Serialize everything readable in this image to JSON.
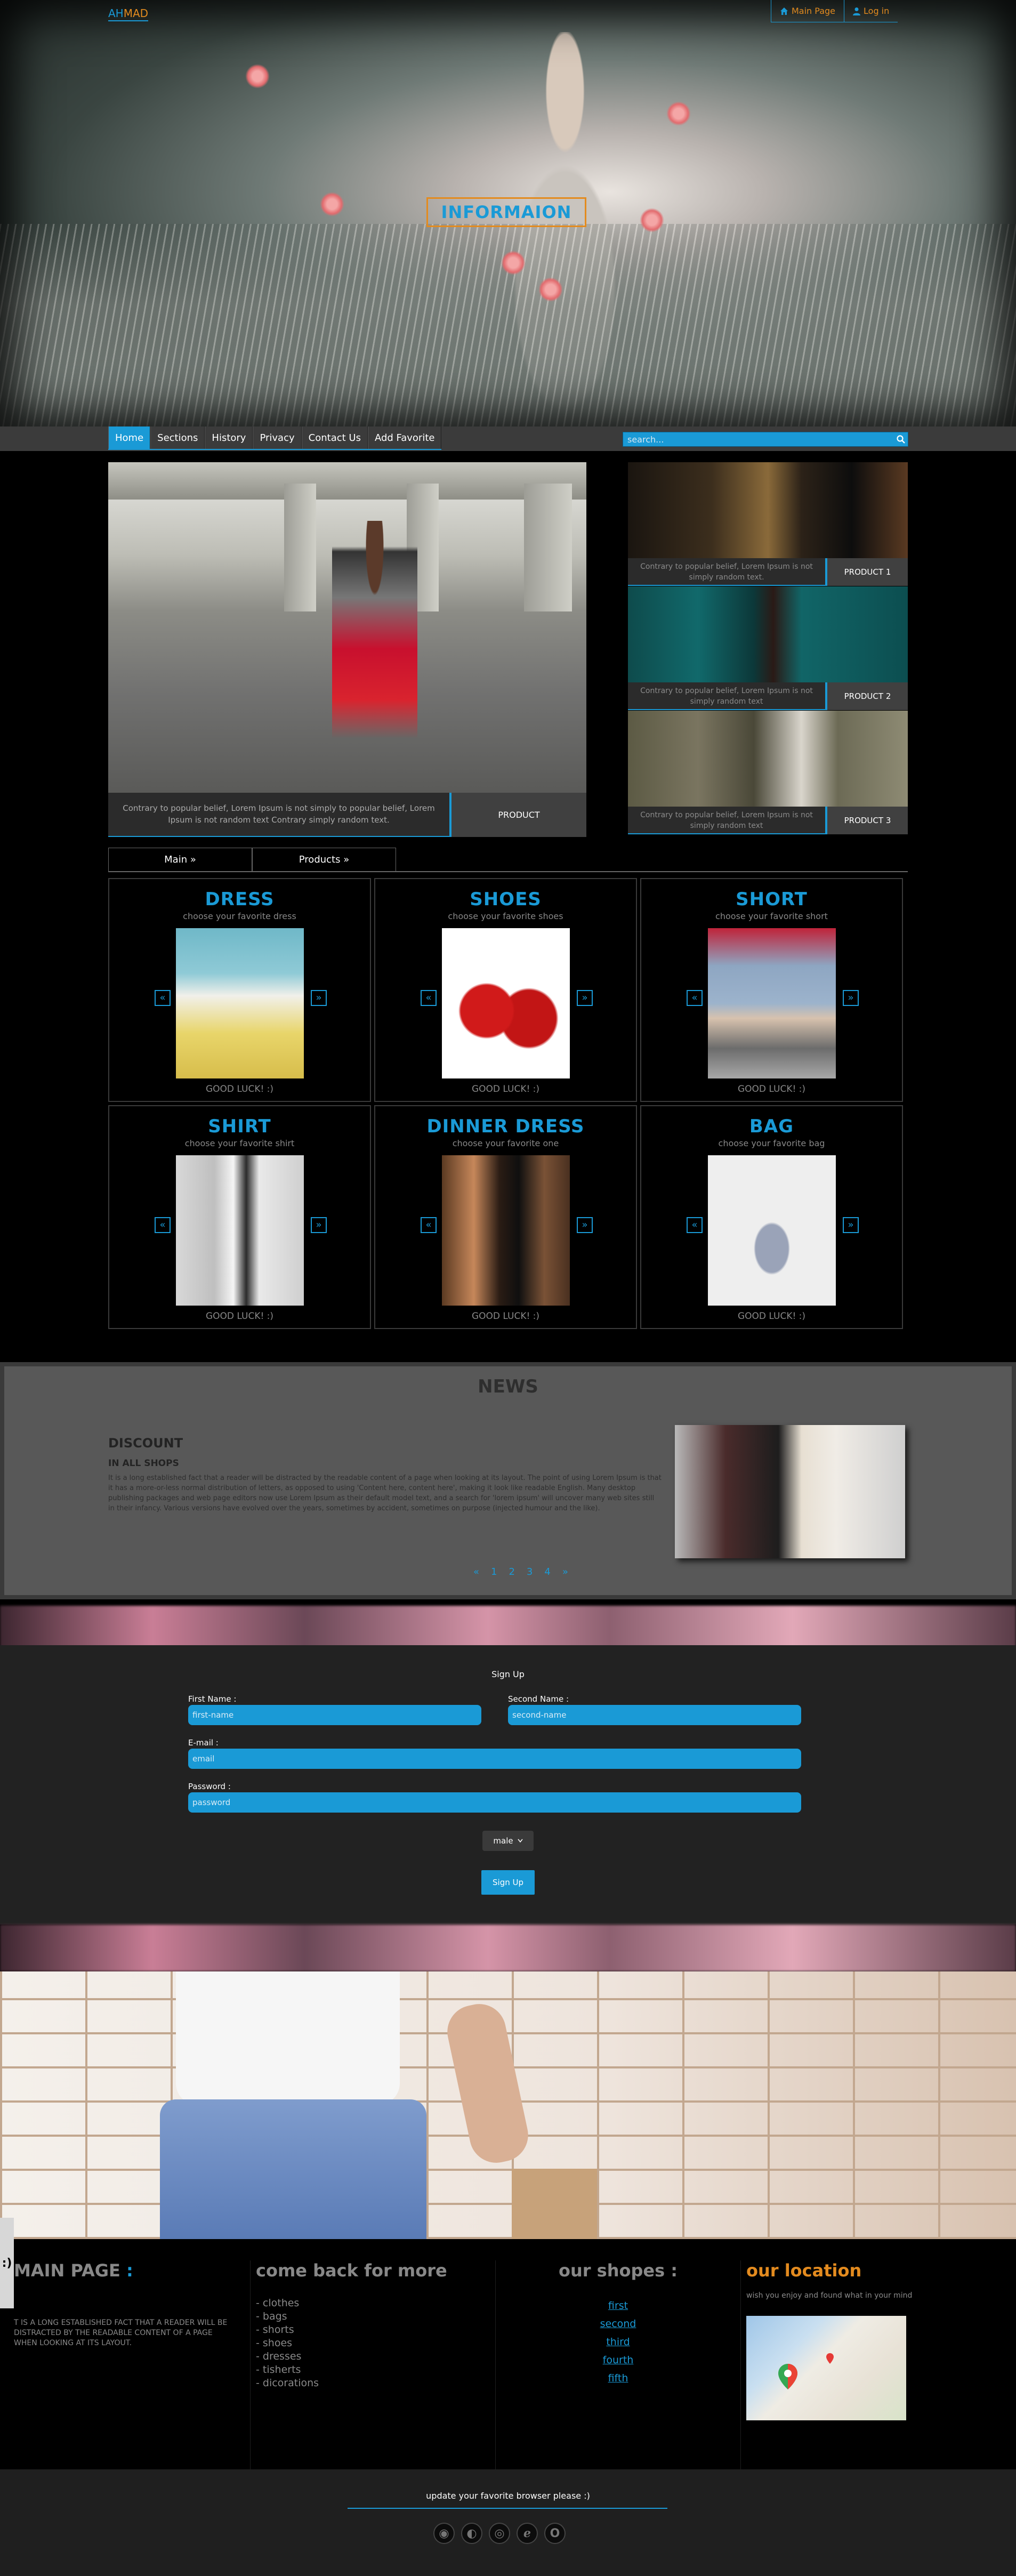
{
  "header": {
    "logo_a": "AH",
    "logo_b": "MAD",
    "top_links": [
      {
        "label": "Main Page",
        "icon": "home-icon"
      },
      {
        "label": "Log in",
        "icon": "user-icon"
      }
    ],
    "hero_title": "INFORMAION"
  },
  "nav": {
    "items": [
      "Home",
      "Sections",
      "History",
      "Privacy",
      "Contact Us",
      "Add Favorite"
    ],
    "search_placeholder": "search..."
  },
  "featured": {
    "main_caption": "Contrary to popular belief, Lorem Ipsum is not simply to popular belief, Lorem Ipsum is not random text Contrary simply random text.",
    "main_button": "PRODUCT",
    "side": [
      {
        "caption": "Contrary to popular belief, Lorem Ipsum is not simply random text.",
        "button": "PRODUCT 1"
      },
      {
        "caption": "Contrary to popular belief, Lorem Ipsum is not simply random text",
        "button": "PRODUCT 2"
      },
      {
        "caption": "Contrary to popular belief, Lorem Ipsum is not simply random text",
        "button": "PRODUCT 3"
      }
    ]
  },
  "subtabs": [
    "Main »",
    "Products »"
  ],
  "products": [
    {
      "title": "DRESS",
      "subtitle": "choose your favorite dress",
      "footer": "GOOD LUCK! :)"
    },
    {
      "title": "SHOES",
      "subtitle": "choose your favorite shoes",
      "footer": "GOOD LUCK! :)"
    },
    {
      "title": "SHORT",
      "subtitle": "choose your favorite short",
      "footer": "GOOD LUCK! :)"
    },
    {
      "title": "SHIRT",
      "subtitle": "choose your favorite shirt",
      "footer": "GOOD LUCK! :)"
    },
    {
      "title": "DINNER DRESS",
      "subtitle": "choose your favorite one",
      "footer": "GOOD LUCK! :)"
    },
    {
      "title": "BAG",
      "subtitle": "choose your favorite bag",
      "footer": "GOOD LUCK! :)"
    }
  ],
  "arrows": {
    "left": "«",
    "right": "»"
  },
  "news": {
    "heading": "NEWS",
    "title": "DISCOUNT",
    "subtitle": "IN ALL SHOPS",
    "body": "It is a long established fact that a reader will be distracted by the readable content of a page when looking at its layout. The point of using Lorem Ipsum is that it has a more-or-less normal distribution of letters, as opposed to using 'Content here, content here', making it look like readable English. Many desktop publishing packages and web page editors now use Lorem Ipsum as their default model text, and a search for 'lorem ipsum' will uncover many web sites still in their infancy. Various versions have evolved over the years, sometimes by accident, sometimes on purpose (injected humour and the like).",
    "pager": [
      "«",
      "1",
      "2",
      "3",
      "4",
      "»"
    ]
  },
  "signup": {
    "title": "Sign Up",
    "first_label": "First Name :",
    "first_placeholder": "first-name",
    "second_label": "Second Name :",
    "second_placeholder": "second-name",
    "email_label": "E-mail :",
    "email_placeholder": "email",
    "password_label": "Password :",
    "password_placeholder": "password",
    "gender": "male",
    "button": "Sign Up"
  },
  "side_tab": ":)",
  "footer": {
    "col1_title": "MAIN PAGE",
    "col1_colon": " :",
    "col1_text": "T IS A LONG ESTABLISHED FACT THAT A READER WILL BE DISTRACTED BY THE READABLE CONTENT OF A PAGE WHEN LOOKING AT ITS LAYOUT.",
    "col2_title": "come back for more",
    "col2_items": [
      "- clothes",
      "- bags",
      "- shorts",
      "- shoes",
      "- dresses",
      "- tisherts",
      "- dicorations"
    ],
    "col3_title": "our shopes :",
    "col3_links": [
      "first",
      "second",
      "third",
      "fourth",
      "fifth"
    ],
    "col4_title": "our location",
    "col4_text": "wish you enjoy and found what in your mind",
    "update_text": "update your favorite browser please :)",
    "browsers": [
      "chrome-icon",
      "firefox-icon",
      "opera-icon",
      "edge-icon",
      "ie-icon"
    ]
  },
  "colors": {
    "accent": "#1a9ad6",
    "orange": "#e38b1f",
    "dark": "#222222"
  }
}
